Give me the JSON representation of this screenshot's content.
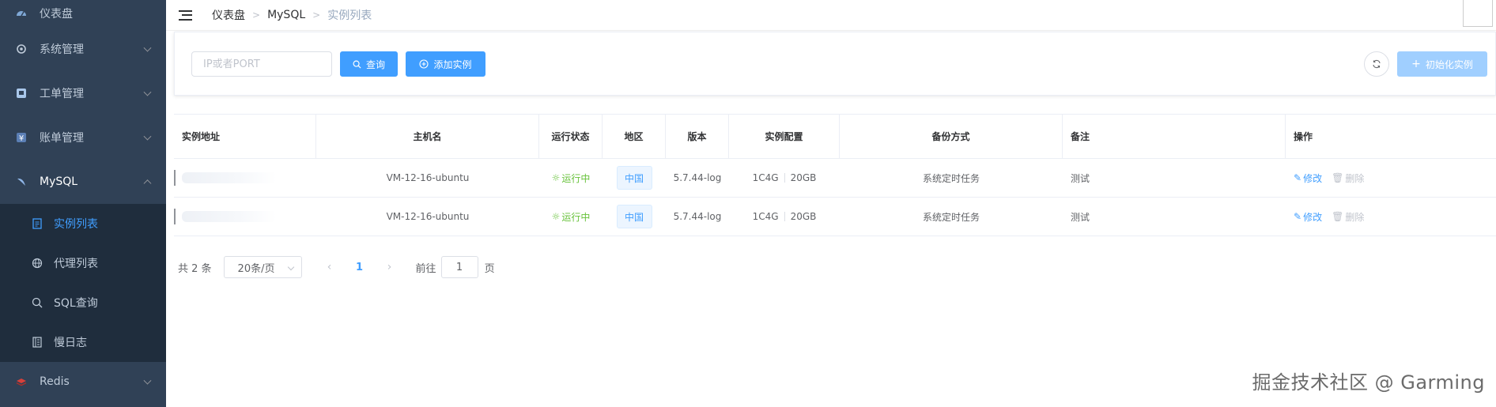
{
  "sidebar": {
    "items": [
      {
        "label": "仪表盘",
        "icon": "dashboard-icon"
      },
      {
        "label": "系统管理",
        "icon": "settings-icon"
      },
      {
        "label": "工单管理",
        "icon": "ticket-icon"
      },
      {
        "label": "账单管理",
        "icon": "yen-icon"
      },
      {
        "label": "MySQL",
        "icon": "mysql-icon"
      }
    ],
    "mysql_sub": [
      {
        "label": "实例列表",
        "icon": "document-icon",
        "active": true
      },
      {
        "label": "代理列表",
        "icon": "globe-icon"
      },
      {
        "label": "SQL查询",
        "icon": "search-icon"
      },
      {
        "label": "慢日志",
        "icon": "log-icon"
      }
    ],
    "redis": {
      "label": "Redis",
      "icon": "redis-icon"
    }
  },
  "breadcrumb": {
    "items": [
      "仪表盘",
      "MySQL",
      "实例列表"
    ]
  },
  "search": {
    "placeholder": "IP或者PORT",
    "query_label": "查询",
    "add_label": "添加实例",
    "init_label": "初始化实例"
  },
  "table": {
    "columns": [
      "实例地址",
      "主机名",
      "运行状态",
      "地区",
      "版本",
      "实例配置",
      "备份方式",
      "备注",
      "操作"
    ],
    "rows": [
      {
        "hostname": "VM-12-16-ubuntu",
        "status": "运行中",
        "region": "中国",
        "version": "5.7.44-log",
        "cpu": "1C4G",
        "disk": "20GB",
        "backup": "系统定时任务",
        "note": "测试",
        "edit": "修改",
        "delete": "删除"
      },
      {
        "hostname": "VM-12-16-ubuntu",
        "status": "运行中",
        "region": "中国",
        "version": "5.7.44-log",
        "cpu": "1C4G",
        "disk": "20GB",
        "backup": "系统定时任务",
        "note": "测试",
        "edit": "修改",
        "delete": "删除"
      }
    ]
  },
  "pagination": {
    "total": "共 2 条",
    "page_size": "20条/页",
    "current": "1",
    "goto_label": "前往",
    "goto_value": "1",
    "page_unit": "页"
  },
  "watermark": "掘金技术社区 @ Garming",
  "colors": {
    "primary": "#409eff",
    "sidebar_bg": "#304156",
    "submenu_bg": "#1f2d3d",
    "success": "#67c23a"
  }
}
